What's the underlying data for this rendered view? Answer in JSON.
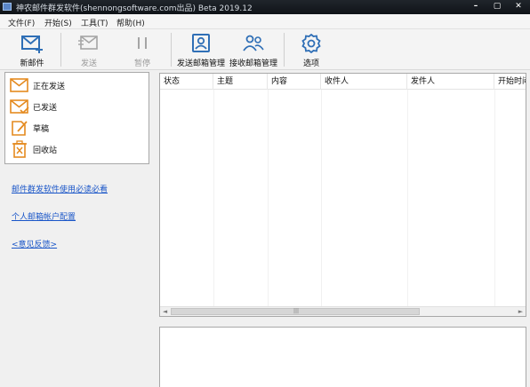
{
  "window": {
    "title": "神农邮件群发软件(shennongsoftware.com出品) Beta 2019.12",
    "controls": [
      "–",
      "▢",
      "✕"
    ]
  },
  "menu": [
    "文件(F)",
    "开始(S)",
    "工具(T)",
    "帮助(H)"
  ],
  "toolbar": {
    "new_mail": "新邮件",
    "send": "发送",
    "pause": "暂停",
    "send_mailbox_mgmt": "发送邮箱管理",
    "recv_mailbox_mgmt": "接收邮箱管理",
    "options": "选项"
  },
  "folders": [
    {
      "label": "正在发送",
      "icon": "sending-mail-icon"
    },
    {
      "label": "已发送",
      "icon": "sent-mail-icon"
    },
    {
      "label": "草稿",
      "icon": "draft-icon"
    },
    {
      "label": "回收站",
      "icon": "recycle-bin-icon"
    }
  ],
  "links": {
    "manual": "邮件群发软件使用必读必看",
    "account_config": "个人邮箱帐户配置",
    "feedback": "<意见反馈>"
  },
  "table": {
    "columns": [
      "状态",
      "主题",
      "内容",
      "收件人",
      "发件人",
      "开始时间"
    ],
    "rows": []
  },
  "scrollbar": {
    "left_arrow": "◄",
    "right_arrow": "►",
    "grip": "|||"
  },
  "colors": {
    "accent_blue": "#2f6fb6",
    "folder_orange": "#e48a1f",
    "link": "#1a56c8"
  }
}
